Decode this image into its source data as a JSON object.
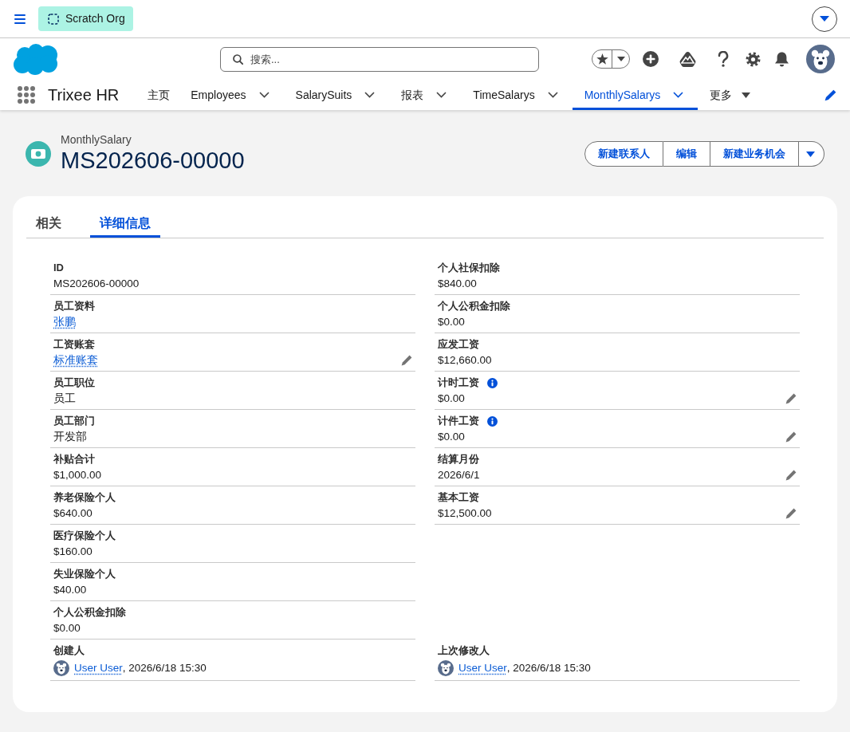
{
  "environment_bar": {
    "org_badge": "Scratch Org"
  },
  "global_header": {
    "search": {
      "placeholder": "搜索..."
    }
  },
  "nav": {
    "app_name": "Trixee HR",
    "items": [
      {
        "label": "主页",
        "kind": "tab",
        "has_menu": false,
        "selected": false
      },
      {
        "label": "Employees",
        "kind": "tab",
        "has_menu": true,
        "selected": false
      },
      {
        "label": "SalarySuits",
        "kind": "tab",
        "has_menu": true,
        "selected": false
      },
      {
        "label": "报表",
        "kind": "tab",
        "has_menu": true,
        "selected": false
      },
      {
        "label": "TimeSalarys",
        "kind": "tab",
        "has_menu": true,
        "selected": false
      },
      {
        "label": "MonthlySalarys",
        "kind": "tab",
        "has_menu": true,
        "selected": true
      },
      {
        "label": "更多",
        "kind": "overflow",
        "has_menu": true,
        "selected": false
      }
    ]
  },
  "record": {
    "object_type": "MonthlySalary",
    "title": "MS202606-00000",
    "actions": [
      "新建联系人",
      "编辑",
      "新建业务机会"
    ]
  },
  "record_tabs": [
    {
      "label": "相关",
      "selected": false
    },
    {
      "label": "详细信息",
      "selected": true
    }
  ],
  "details": {
    "left_fields": [
      {
        "label": "ID",
        "value": "MS202606-00000",
        "kind": "text",
        "editable": false,
        "help": false
      },
      {
        "label": "员工资料",
        "value": "张鹏",
        "kind": "link",
        "editable": false,
        "help": false
      },
      {
        "label": "工资账套",
        "value": "标准账套",
        "kind": "link",
        "editable": true,
        "help": false
      },
      {
        "label": "员工职位",
        "value": "员工",
        "kind": "text",
        "editable": false,
        "help": false
      },
      {
        "label": "员工部门",
        "value": "开发部",
        "kind": "text",
        "editable": false,
        "help": false
      },
      {
        "label": "补贴合计",
        "value": "$1,000.00",
        "kind": "text",
        "editable": false,
        "help": false
      },
      {
        "label": "养老保险个人",
        "value": "$640.00",
        "kind": "text",
        "editable": false,
        "help": false
      },
      {
        "label": "医疗保险个人",
        "value": "$160.00",
        "kind": "text",
        "editable": false,
        "help": false
      },
      {
        "label": "失业保险个人",
        "value": "$40.00",
        "kind": "text",
        "editable": false,
        "help": false
      },
      {
        "label": "个人公积金扣除",
        "value": "$0.00",
        "kind": "text",
        "editable": false,
        "help": false
      }
    ],
    "right_fields": [
      {
        "label": "个人社保扣除",
        "value": "$840.00",
        "kind": "text",
        "editable": false,
        "help": false
      },
      {
        "label": "个人公积金扣除",
        "value": "$0.00",
        "kind": "text",
        "editable": false,
        "help": false
      },
      {
        "label": "应发工资",
        "value": "$12,660.00",
        "kind": "text",
        "editable": false,
        "help": false
      },
      {
        "label": "计时工资",
        "value": "$0.00",
        "kind": "text",
        "editable": true,
        "help": true
      },
      {
        "label": "计件工资",
        "value": "$0.00",
        "kind": "text",
        "editable": true,
        "help": true
      },
      {
        "label": "结算月份",
        "value": "2026/6/1",
        "kind": "text",
        "editable": true,
        "help": false
      },
      {
        "label": "基本工资",
        "value": "$12,500.00",
        "kind": "text",
        "editable": true,
        "help": false
      }
    ],
    "system_fields": [
      {
        "label": "创建人",
        "user": "User User",
        "suffix": ", 2026/6/18 15:30"
      },
      {
        "label": "上次修改人",
        "user": "User User",
        "suffix": ", 2026/6/18 15:30"
      }
    ]
  }
}
